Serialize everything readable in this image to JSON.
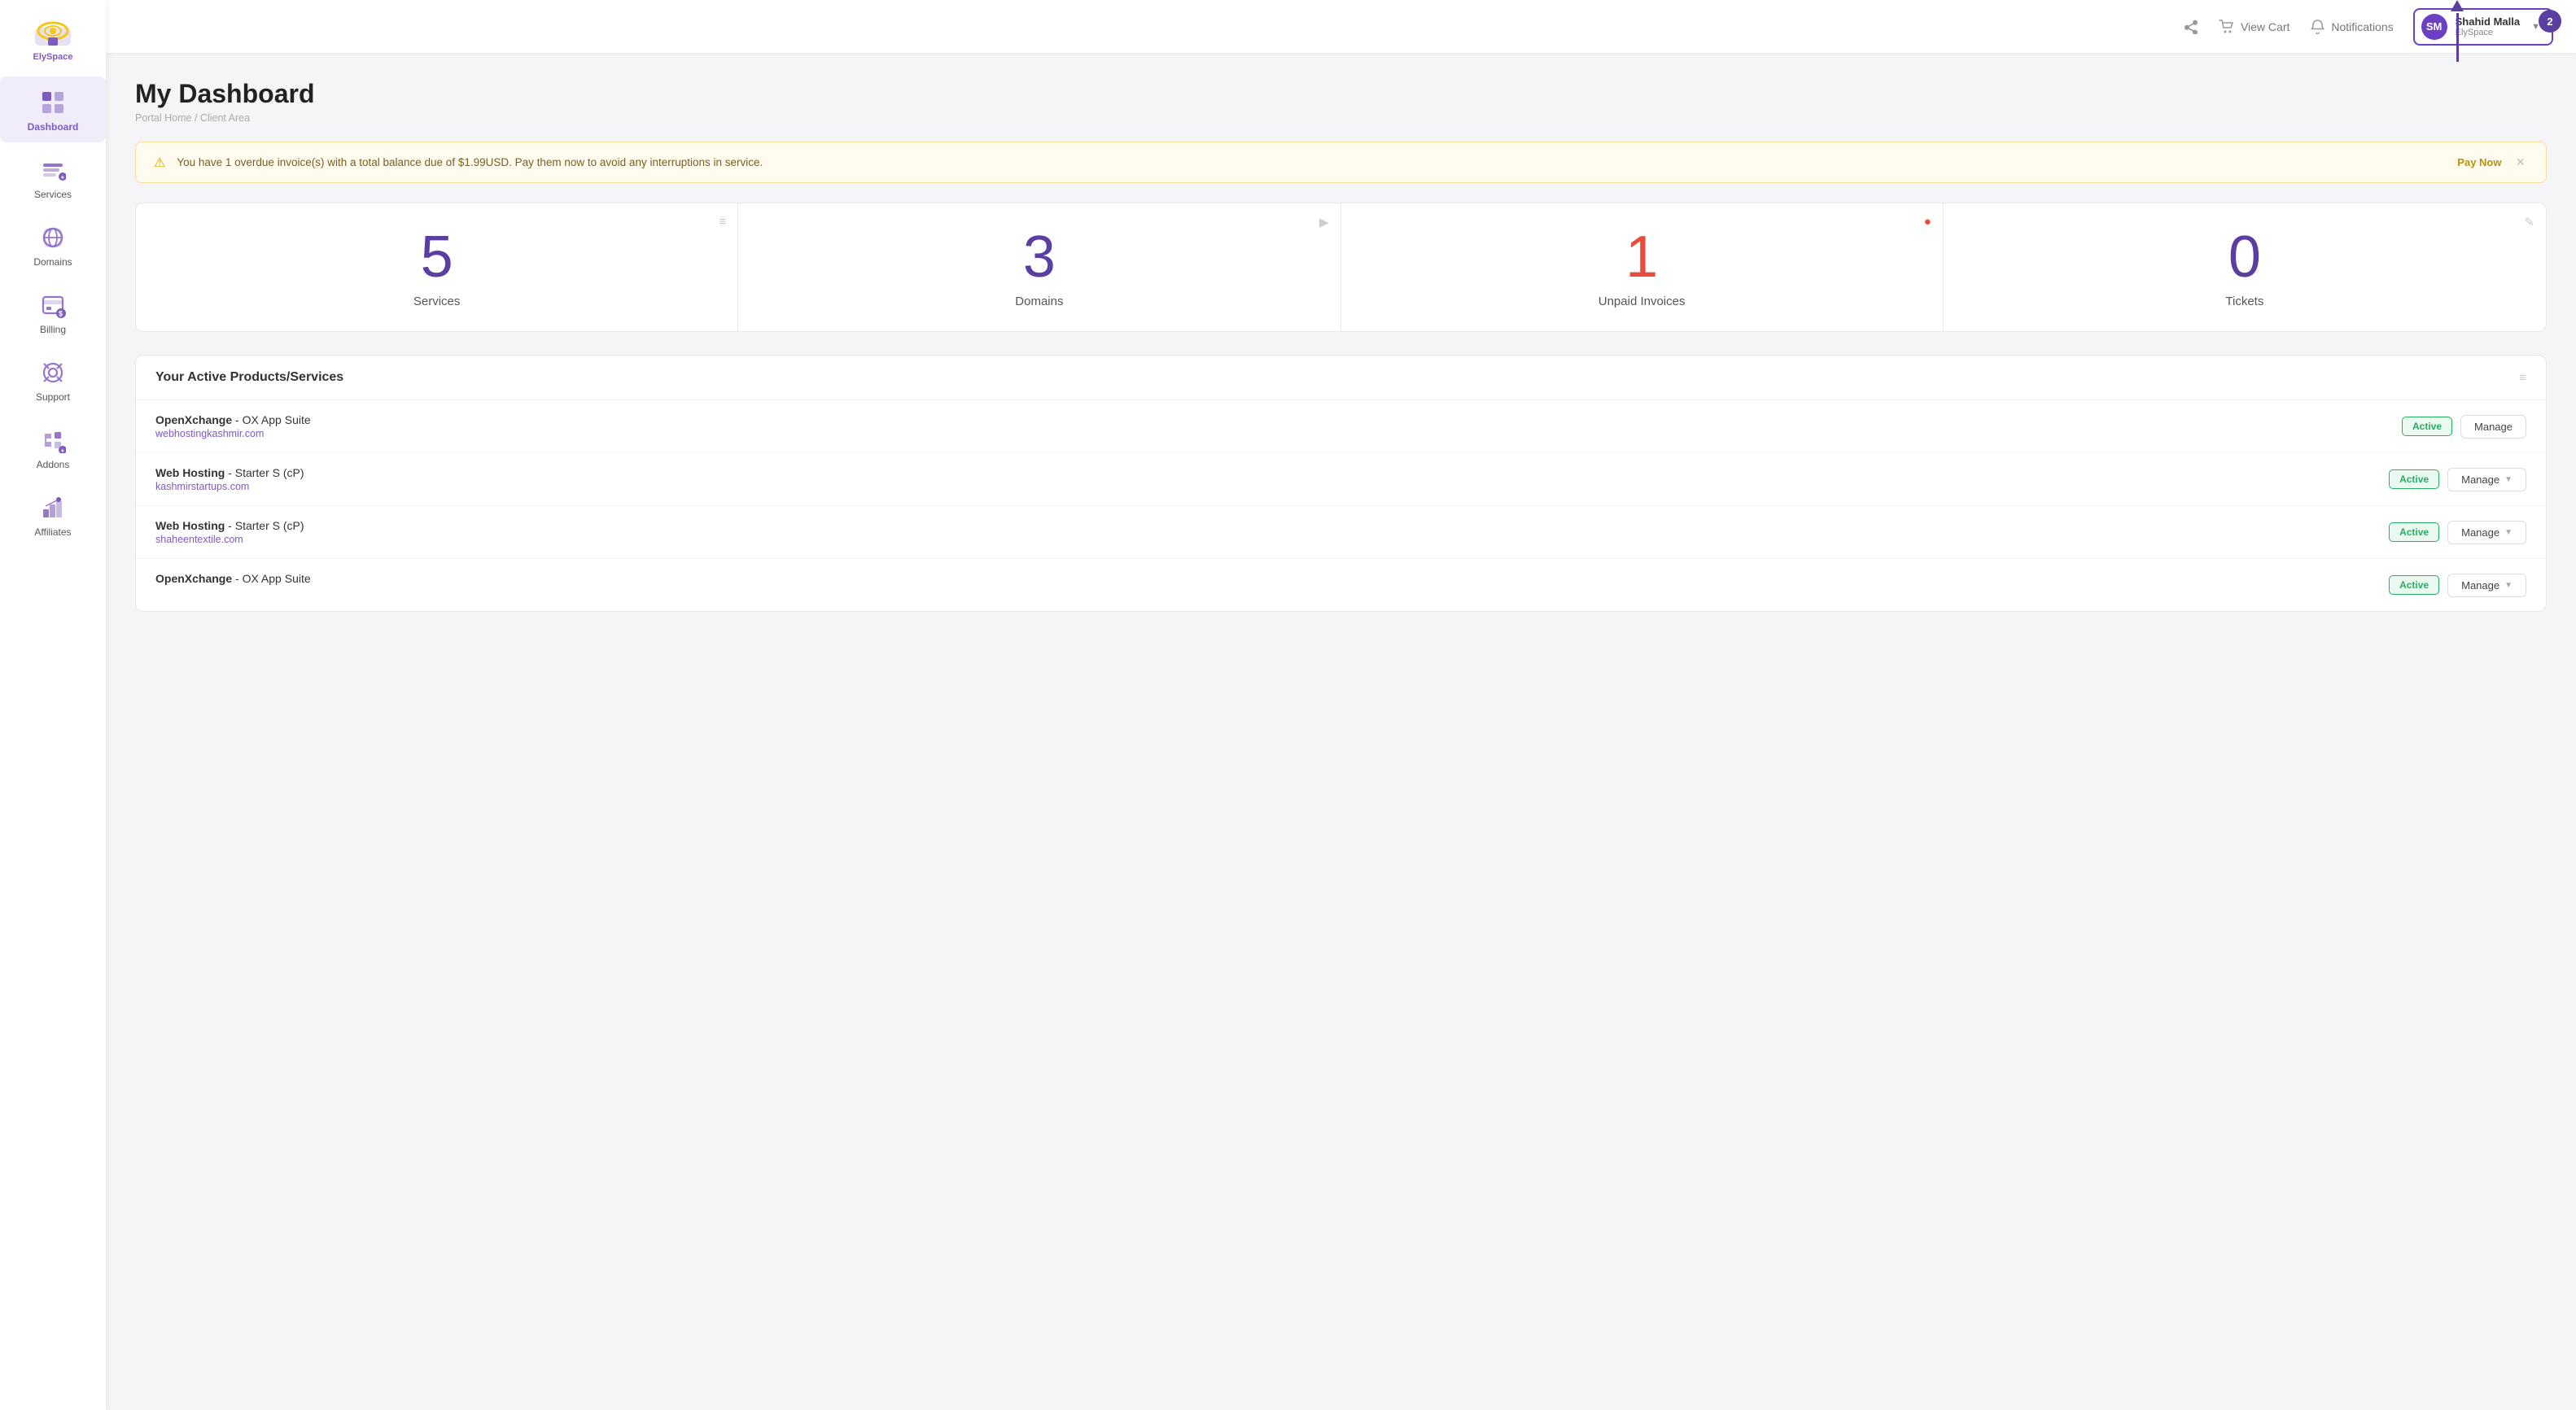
{
  "logo": {
    "text": "ElySpace",
    "alt": "ElySpace logo"
  },
  "sidebar": {
    "items": [
      {
        "id": "dashboard",
        "label": "Dashboard",
        "active": true
      },
      {
        "id": "services",
        "label": "Services",
        "active": false
      },
      {
        "id": "domains",
        "label": "Domains",
        "active": false
      },
      {
        "id": "billing",
        "label": "Billing",
        "active": false
      },
      {
        "id": "support",
        "label": "Support",
        "active": false
      },
      {
        "id": "addons",
        "label": "Addons",
        "active": false
      },
      {
        "id": "affiliates",
        "label": "Affiliates",
        "active": false
      }
    ]
  },
  "topbar": {
    "view_cart_label": "View Cart",
    "notifications_label": "Notifications",
    "user_name": "Shahid Malla",
    "user_org": "ElySpace",
    "notification_count": "2"
  },
  "page": {
    "title": "My Dashboard",
    "breadcrumb_home": "Portal Home",
    "breadcrumb_sep": "/",
    "breadcrumb_current": "Client Area"
  },
  "alert": {
    "text": "You have 1 overdue invoice(s) with a total balance due of $1.99USD. Pay them now to avoid any interruptions in service.",
    "pay_now_label": "Pay Now"
  },
  "stats": [
    {
      "id": "services",
      "number": "5",
      "label": "Services",
      "color": "purple",
      "icon": "≡"
    },
    {
      "id": "domains",
      "number": "3",
      "label": "Domains",
      "color": "purple",
      "icon": "▶"
    },
    {
      "id": "invoices",
      "number": "1",
      "label": "Unpaid Invoices",
      "color": "red",
      "icon": "!"
    },
    {
      "id": "tickets",
      "number": "0",
      "label": "Tickets",
      "color": "purple",
      "icon": "✎"
    }
  ],
  "products_section": {
    "title": "Your Active Products/Services",
    "items": [
      {
        "name": "OpenXchange",
        "description": "OX App Suite",
        "domain": "webhostingkashmir.com",
        "status": "Active"
      },
      {
        "name": "Web Hosting",
        "description": "Starter S (cP)",
        "domain": "kashmirstartups.com",
        "status": "Active"
      },
      {
        "name": "Web Hosting",
        "description": "Starter S (cP)",
        "domain": "shaheentextile.com",
        "status": "Active"
      },
      {
        "name": "OpenXchange",
        "description": "OX App Suite",
        "domain": "",
        "status": "Active"
      }
    ],
    "manage_label": "Manage"
  }
}
